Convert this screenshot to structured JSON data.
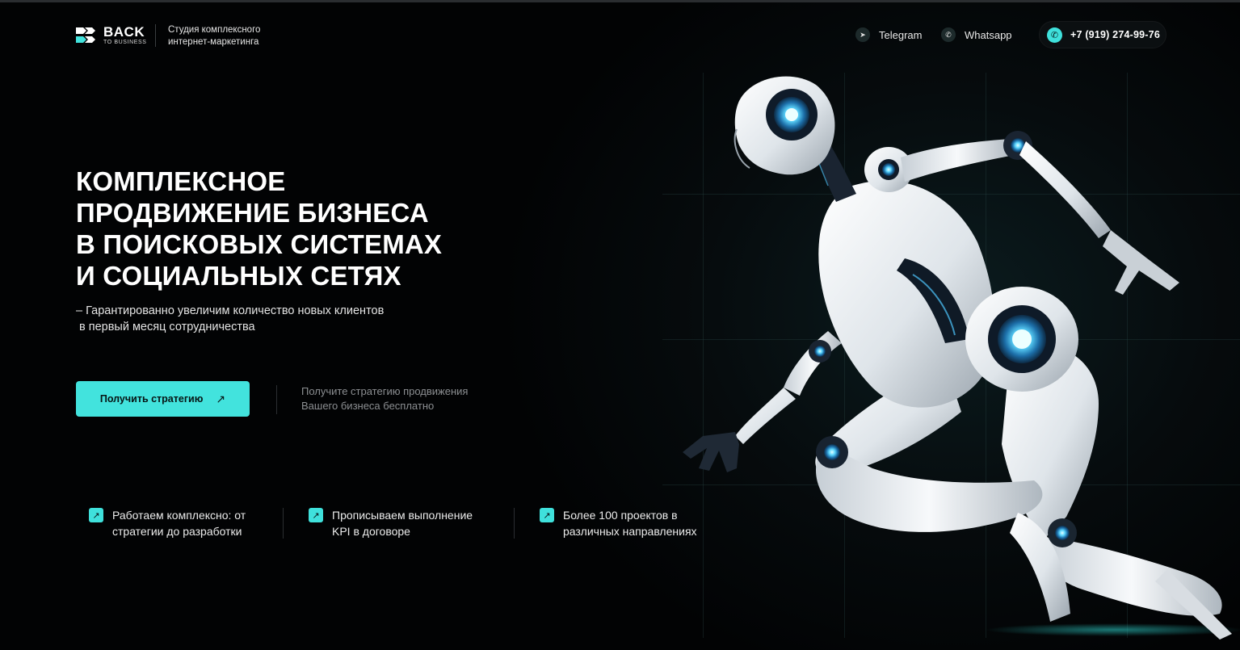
{
  "header": {
    "logo_main": "BACK",
    "logo_sub": "TO BUSINESS",
    "tagline_line1": "Студия комплексного",
    "tagline_line2": "интернет-маркетинга",
    "links": [
      {
        "label": "Telegram",
        "icon": "telegram-icon"
      },
      {
        "label": "Whatsapp",
        "icon": "whatsapp-icon"
      }
    ],
    "phone": "+7 (919) 274-99-76",
    "phone_icon": "phone-icon"
  },
  "hero": {
    "title_lines": [
      "КОМПЛЕКСНОЕ",
      "ПРОДВИЖЕНИЕ БИЗНЕСА",
      "В ПОИСКОВЫХ СИСТЕМАХ",
      "И СОЦИАЛЬНЫХ СЕТЯХ"
    ],
    "subtitle_line1": "– Гарантированно увеличим количество новых  клиентов",
    "subtitle_line2": "в первый месяц сотрудничества",
    "cta_label": "Получить стратегию",
    "cta_icon": "arrow-up-right-icon",
    "cta_note_line1": "Получите стратегию продвижения",
    "cta_note_line2": "Вашего бизнеса бесплатно"
  },
  "features": [
    {
      "line1": "Работаем комплексно: от",
      "line2": "стратегии до разработки",
      "icon": "arrow-up-right-icon"
    },
    {
      "line1": "Прописываем выполнение",
      "line2": "KPI в договоре",
      "icon": "arrow-up-right-icon"
    },
    {
      "line1": "Более 100 проектов в",
      "line2": "различных направлениях",
      "icon": "arrow-up-right-icon"
    }
  ],
  "colors": {
    "accent": "#42e3dd",
    "background": "#020304",
    "text": "#ffffff",
    "muted": "#8c8f92"
  }
}
